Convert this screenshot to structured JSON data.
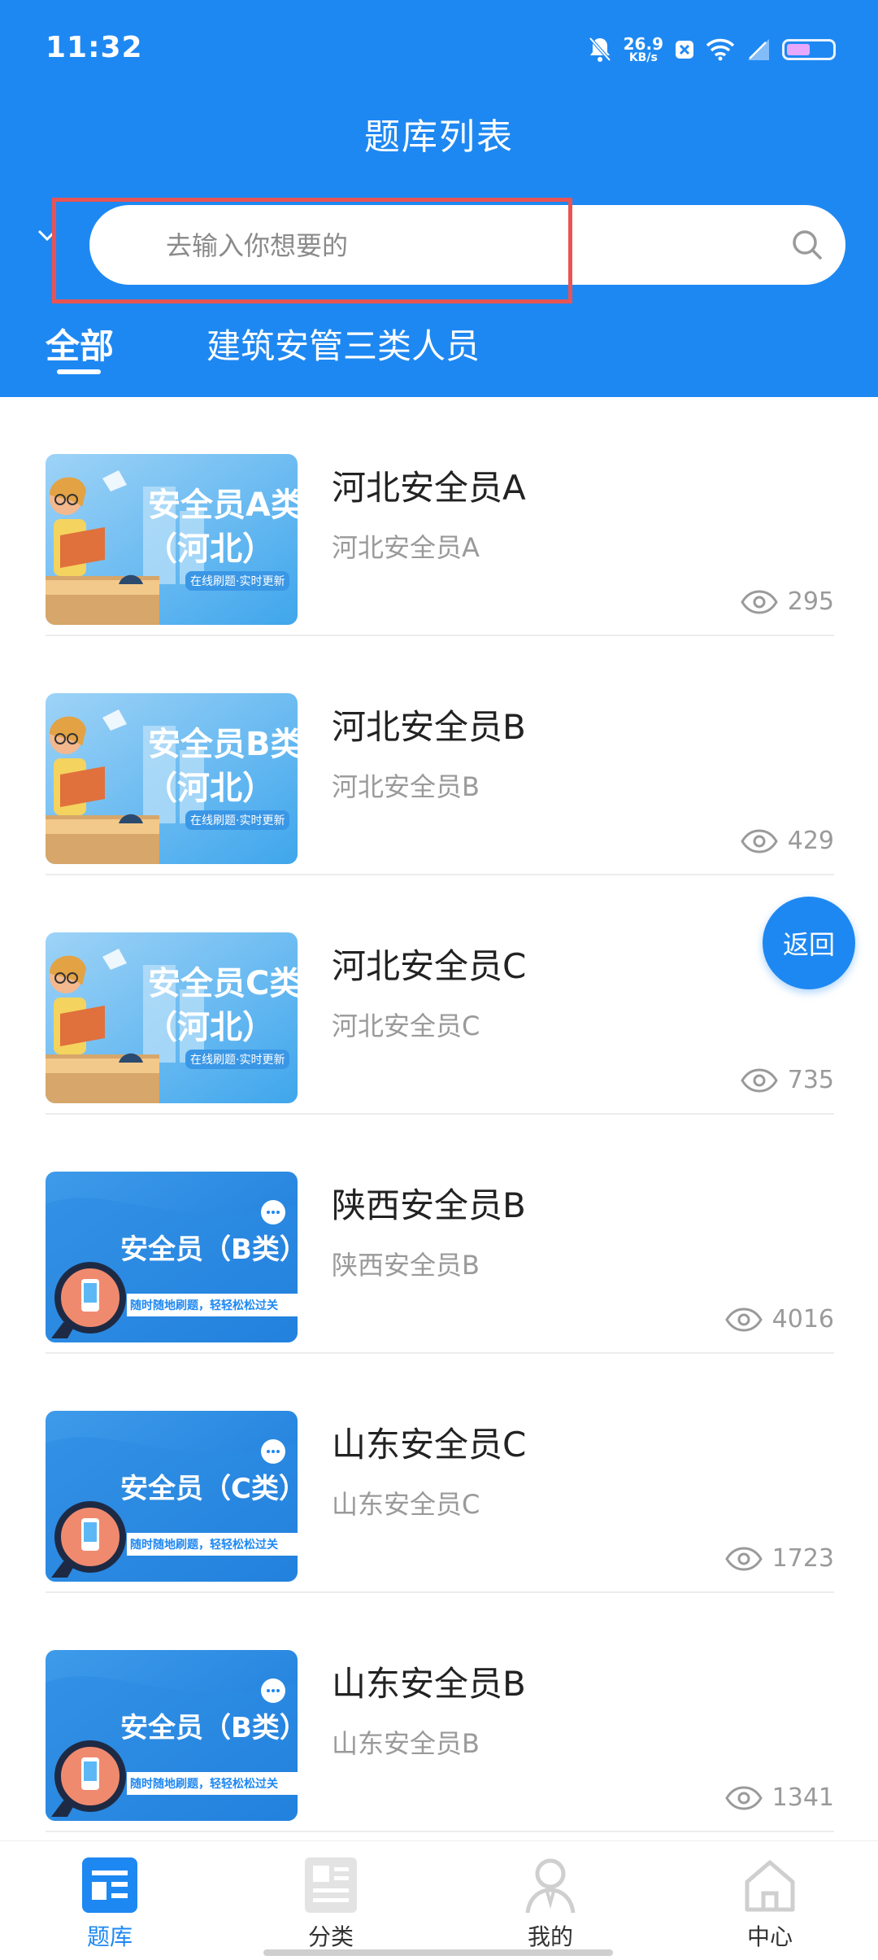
{
  "status_bar": {
    "time": "11:32",
    "net_speed_value": "26.9",
    "net_speed_unit": "KB/s",
    "icons": [
      "mute-icon",
      "close-badge-icon",
      "wifi-icon",
      "signal-off-icon",
      "battery-icon"
    ]
  },
  "header": {
    "title": "题库列表",
    "search": {
      "placeholder": "去输入你想要的",
      "value": ""
    },
    "tabs": [
      {
        "label": "全部",
        "active": true
      },
      {
        "label": "建筑安管三类人员",
        "active": false
      }
    ]
  },
  "list": {
    "items": [
      {
        "title": "河北安全员A",
        "subtitle": "河北安全员A",
        "views": "295",
        "thumb": {
          "banner": "安全员A类",
          "region": "（河北）",
          "tag": "在线刷题·实时更新"
        }
      },
      {
        "title": "河北安全员B",
        "subtitle": "河北安全员B",
        "views": "429",
        "thumb": {
          "banner": "安全员B类",
          "region": "（河北）",
          "tag": "在线刷题·实时更新"
        }
      },
      {
        "title": "河北安全员C",
        "subtitle": "河北安全员C",
        "views": "735",
        "thumb": {
          "banner": "安全员C类",
          "region": "（河北）",
          "tag": "在线刷题·实时更新"
        }
      },
      {
        "title": "陕西安全员B",
        "subtitle": "陕西安全员B",
        "views": "4016",
        "thumb": {
          "banner": "安全员（B类）",
          "tag": "随时随地刷题，轻轻松松过关"
        }
      },
      {
        "title": "山东安全员C",
        "subtitle": "山东安全员C",
        "views": "1723",
        "thumb": {
          "banner": "安全员（C类）",
          "tag": "随时随地刷题，轻轻松松过关"
        }
      },
      {
        "title": "山东安全员B",
        "subtitle": "山东安全员B",
        "views": "1341",
        "thumb": {
          "banner": "安全员（B类）",
          "tag": "随时随地刷题，轻轻松松过关"
        }
      }
    ]
  },
  "fab": {
    "label": "返回"
  },
  "bottom_nav": [
    {
      "label": "题库",
      "icon": "question-bank-icon",
      "active": true
    },
    {
      "label": "分类",
      "icon": "category-icon",
      "active": false
    },
    {
      "label": "我的",
      "icon": "profile-icon",
      "active": false
    },
    {
      "label": "中心",
      "icon": "home-icon",
      "active": false
    }
  ],
  "colors": {
    "primary": "#1E88F2",
    "highlight_box": "#E85454"
  }
}
